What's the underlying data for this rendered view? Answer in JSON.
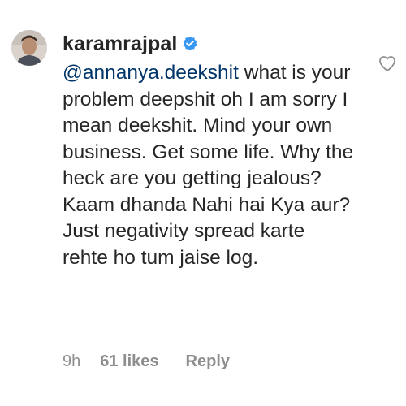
{
  "comment": {
    "username": "karamrajpal",
    "verified": true,
    "mention": "@annanya.deekshit",
    "text": " what is your problem deepshit oh I am sorry I mean deekshit. Mind your own business. Get some life. Why the heck are you getting jealous? Kaam dhanda Nahi hai Kya aur? Just negativity spread karte rehte ho tum jaise log.",
    "time": "9h",
    "likes": "61 likes",
    "reply_label": "Reply"
  },
  "icons": {
    "verified": "verified-badge-icon",
    "like": "heart-outline-icon"
  },
  "colors": {
    "text": "#262626",
    "mention": "#003569",
    "meta": "#8e8e8e",
    "verified": "#3897f0"
  }
}
